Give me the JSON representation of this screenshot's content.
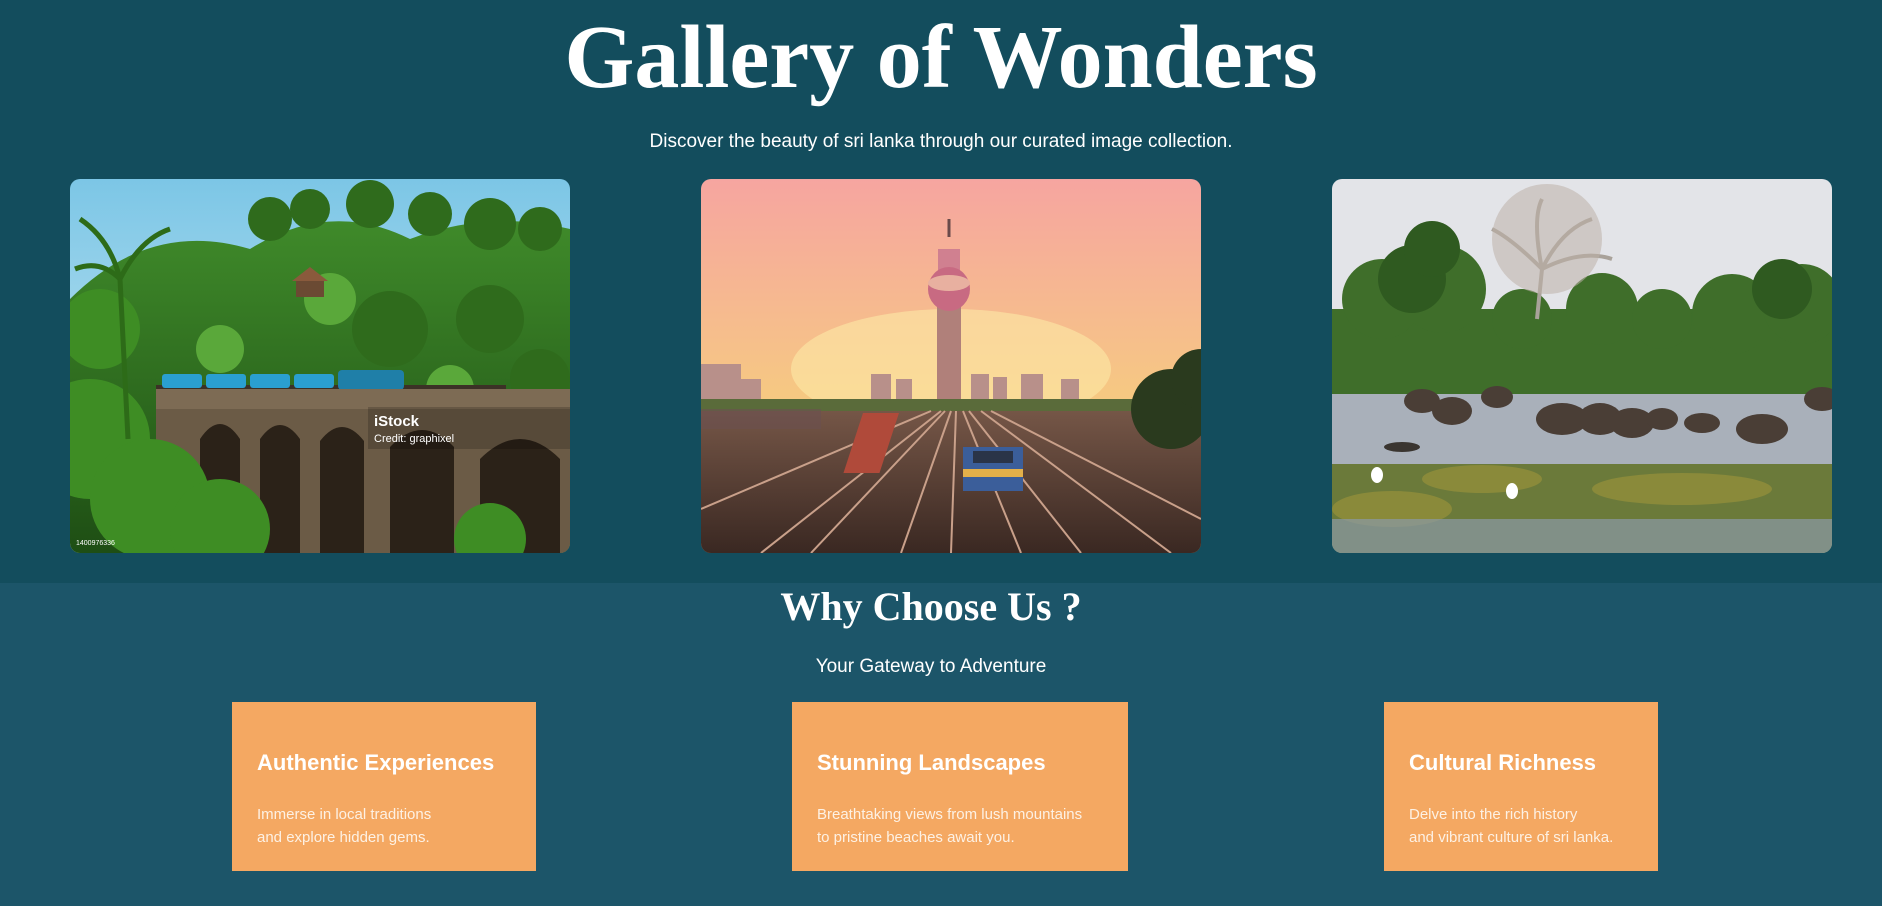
{
  "gallery": {
    "title": "Gallery of Wonders",
    "subtitle": "Discover the beauty of sri lanka through our curated image collection.",
    "images": [
      {
        "subject": "train crossing a stone arch bridge through green hills",
        "watermark": "iStock",
        "credit": "Credit: graphixel",
        "stock_id": "1400976336"
      },
      {
        "subject": "city tower at sunset above railway tracks with a train"
      },
      {
        "subject": "elephants bathing in a wetland lake with trees"
      }
    ]
  },
  "why": {
    "title": "Why Choose Us ?",
    "subtitle": "Your Gateway to Adventure",
    "cards": [
      {
        "title": "Authentic Experiences",
        "line1": "Immerse in local traditions",
        "line2": "and explore hidden gems."
      },
      {
        "title": "Stunning Landscapes",
        "line1": "Breathtaking views from lush mountains",
        "line2": "to pristine beaches await you."
      },
      {
        "title": "Cultural Richness",
        "line1": "Delve into the rich history",
        "line2": "and vibrant culture of sri lanka."
      }
    ]
  },
  "colors": {
    "gallery_background": "#134d5d",
    "page_background": "#1c5569",
    "card_background": "#f4a862",
    "text": "#ffffff"
  }
}
